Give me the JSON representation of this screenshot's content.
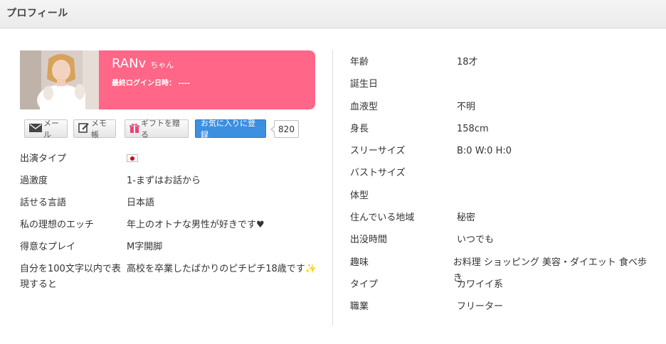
{
  "header": {
    "title": "プロフィール"
  },
  "profile": {
    "name": "RANv",
    "suffix": "ちゃん",
    "last_login_label": "最終ログイン日時：",
    "last_login_value": "----",
    "photo_icon": "profile-photo"
  },
  "actions": {
    "mail_label": "メール",
    "memo_label": "メモ帳",
    "gift_label": "ギフトを贈る",
    "favorite_label": "お気に入りに登録",
    "favorite_count": "820",
    "colors": {
      "favorite": "#3d8fe0",
      "card": "#ff6687"
    }
  },
  "left_details": [
    {
      "label": "出演タイプ",
      "value": "",
      "icon": "japan-flag"
    },
    {
      "label": "過激度",
      "value": "1-まずはお話から"
    },
    {
      "label": "話せる言語",
      "value": "日本語"
    },
    {
      "label": "私の理想のエッチ",
      "value": "年上のオトナな男性が好きです♥"
    },
    {
      "label": "得意なプレイ",
      "value": "M字開脚"
    },
    {
      "label": "自分を100文字以内で表現すると",
      "value": "高校を卒業したばかりのピチピチ18歳です✨"
    }
  ],
  "right_details": [
    {
      "label": "年齢",
      "value": "18才"
    },
    {
      "label": "誕生日",
      "value": ""
    },
    {
      "label": "血液型",
      "value": "不明"
    },
    {
      "label": "身長",
      "value": "158cm"
    },
    {
      "label": "スリーサイズ",
      "value": "B:0 W:0 H:0"
    },
    {
      "label": "バストサイズ",
      "value": ""
    },
    {
      "label": "体型",
      "value": ""
    },
    {
      "label": "住んでいる地域",
      "value": "秘密"
    },
    {
      "label": "出没時間",
      "value": "いつでも"
    },
    {
      "label": "趣味",
      "value": "お料理 ショッピング 美容・ダイエット 食べ歩き"
    },
    {
      "label": "タイプ",
      "value": "カワイイ系"
    },
    {
      "label": "職業",
      "value": "フリーター"
    }
  ]
}
